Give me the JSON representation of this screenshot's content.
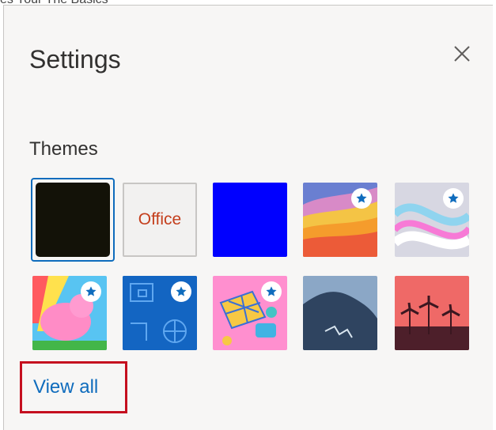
{
  "window": {
    "partial_title": "es Your The Basics"
  },
  "panel": {
    "title": "Settings",
    "close_icon": "close-icon"
  },
  "themes": {
    "section_title": "Themes",
    "selected_index": 0,
    "items": [
      {
        "name": "dark",
        "label": "",
        "premium": false,
        "colors": [
          "#131208"
        ]
      },
      {
        "name": "office",
        "label": "Office",
        "premium": false,
        "colors": [
          "#f2f1f0",
          "#c43e1c"
        ]
      },
      {
        "name": "blue",
        "label": "",
        "premium": false,
        "colors": [
          "#0000ff"
        ]
      },
      {
        "name": "rainbow-waves",
        "label": "",
        "premium": true,
        "colors": [
          "#6a7fd1",
          "#f6b41c",
          "#ec5b38"
        ]
      },
      {
        "name": "silver-ribbons",
        "label": "",
        "premium": true,
        "colors": [
          "#c9c8d8",
          "#f77ad6",
          "#8fd4ef"
        ]
      },
      {
        "name": "rainbow-dragon",
        "label": "",
        "premium": true,
        "colors": [
          "#58c4f2",
          "#ff5da2",
          "#ffe14d"
        ]
      },
      {
        "name": "blue-doodles",
        "label": "",
        "premium": true,
        "colors": [
          "#1365c2",
          "#3b8fe0"
        ]
      },
      {
        "name": "board-games",
        "label": "",
        "premium": true,
        "colors": [
          "#ff8fcf",
          "#41b3e3",
          "#f7c844"
        ]
      },
      {
        "name": "mountain",
        "label": "",
        "premium": false,
        "colors": [
          "#8ba7c6",
          "#2f4460"
        ]
      },
      {
        "name": "palm-sunset",
        "label": "",
        "premium": false,
        "colors": [
          "#ef6967",
          "#4d1f2a"
        ]
      }
    ]
  },
  "footer": {
    "view_all_label": "View all"
  },
  "colors": {
    "accent": "#0f6cbd",
    "highlight_frame": "#c50f1f"
  }
}
